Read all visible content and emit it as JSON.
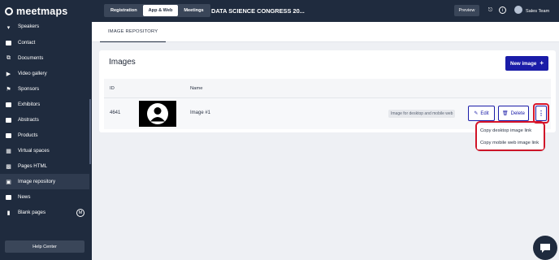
{
  "app": {
    "logo_text": "meetmaps"
  },
  "sidebar": {
    "items": [
      {
        "label": "Speakers",
        "icon": "microphone-icon"
      },
      {
        "label": "Contact",
        "icon": "chat-icon"
      },
      {
        "label": "Documents",
        "icon": "paperclip-icon"
      },
      {
        "label": "Video gallery",
        "icon": "video-icon"
      },
      {
        "label": "Sponsors",
        "icon": "flag-icon"
      },
      {
        "label": "Exhibitors",
        "icon": "store-icon"
      },
      {
        "label": "Abstracts",
        "icon": "book-icon"
      },
      {
        "label": "Products",
        "icon": "tag-icon"
      },
      {
        "label": "Virtual spaces",
        "icon": "map-icon"
      },
      {
        "label": "Pages HTML",
        "icon": "html-icon"
      },
      {
        "label": "Image repository",
        "icon": "image-icon"
      },
      {
        "label": "News",
        "icon": "news-icon"
      },
      {
        "label": "Blank pages",
        "icon": "file-icon",
        "badge": "M"
      }
    ],
    "help_label": "Help Center"
  },
  "topbar": {
    "tabs": [
      "Registration",
      "App & Web",
      "Meetings"
    ],
    "event_title": "DATA SCIENCE CONGRESS 20...",
    "preview_label": "Preview",
    "user_name": "Sales Team"
  },
  "content": {
    "subtab": "IMAGE REPOSITORY",
    "card_title": "Images",
    "new_button": "New image",
    "columns": {
      "id": "ID",
      "name": "Name"
    },
    "row": {
      "id": "4641",
      "name": "Image #1",
      "usage": "Image for desktop and mobile web",
      "edit": "Edit",
      "delete": "Delete"
    },
    "dropdown": [
      "Copy desktop image link",
      "Copy mobile web image link"
    ]
  },
  "colors": {
    "sidebar_bg": "#1f2b3e",
    "primary": "#1a1ca8",
    "highlight": "#d9162a"
  }
}
